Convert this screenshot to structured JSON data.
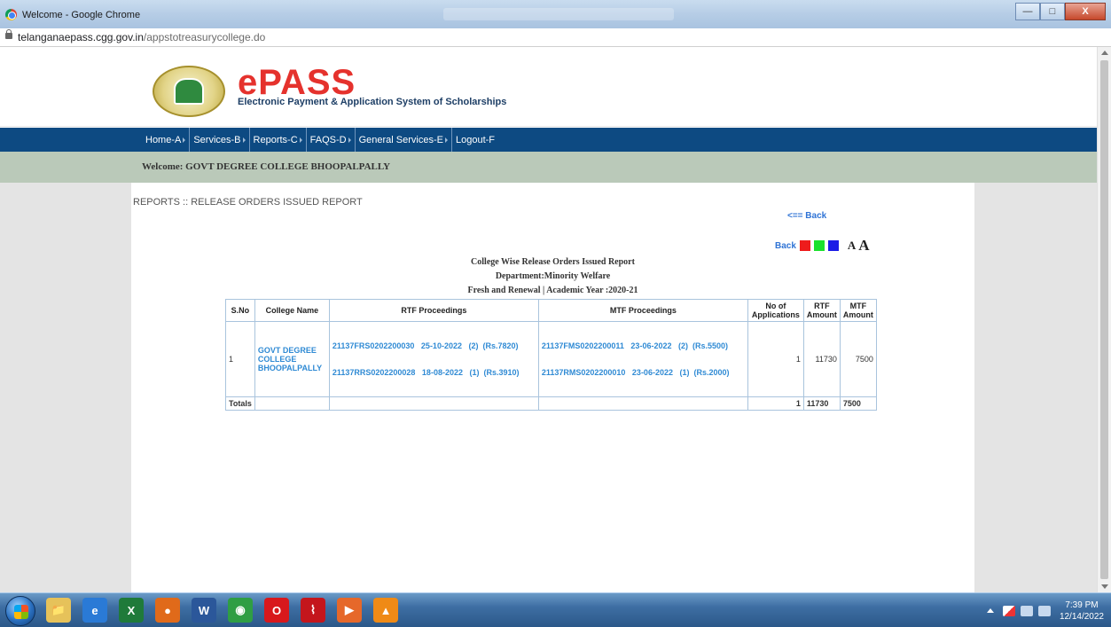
{
  "window": {
    "title": "Welcome - Google Chrome",
    "minimize": "—",
    "maximize": "□",
    "close": "X"
  },
  "address": {
    "host": "telanganaepass.cgg.gov.in",
    "path": "/appstotreasurycollege.do"
  },
  "header": {
    "logo_e": "e",
    "logo_pass": "PASS",
    "tagline": "Electronic Payment & Application System of Scholarships"
  },
  "menu": {
    "items": [
      {
        "label": "Home-A"
      },
      {
        "label": "Services-B"
      },
      {
        "label": "Reports-C"
      },
      {
        "label": "FAQS-D"
      },
      {
        "label": "General Services-E"
      },
      {
        "label": "Logout-F"
      }
    ]
  },
  "welcome": "Welcome: GOVT DEGREE COLLEGE BHOOPALPALLY",
  "report": {
    "breadcrumb": "REPORTS :: RELEASE ORDERS ISSUED REPORT",
    "back_top": "<== Back",
    "tools_back": "Back",
    "font_small": "A",
    "font_large": "A",
    "heading1": "College Wise Release Orders Issued Report",
    "heading2": "Department:Minority Welfare",
    "heading3": "Fresh and Renewal | Academic Year :2020-21",
    "columns": {
      "sno": "S.No",
      "college": "College Name",
      "rtf": "RTF Proceedings",
      "mtf": "MTF Proceedings",
      "noapp_1": "No of",
      "noapp_2": "Applications",
      "rtfamt_1": "RTF",
      "rtfamt_2": "Amount",
      "mtfamt_1": "MTF",
      "mtfamt_2": "Amount"
    },
    "rows": [
      {
        "sno": "1",
        "college": "GOVT DEGREE COLLEGE BHOOPALPALLY",
        "rtf": [
          "21137FRS0202200030   25-10-2022   (2)  (Rs.7820)",
          "21137RRS0202200028   18-08-2022   (1)  (Rs.3910)"
        ],
        "mtf": [
          "21137FMS0202200011   23-06-2022   (2)  (Rs.5500)",
          "21137RMS0202200010   23-06-2022   (1)  (Rs.2000)"
        ],
        "applications": "1",
        "rtf_amount": "11730",
        "mtf_amount": "7500"
      }
    ],
    "totals": {
      "label": "Totals",
      "applications": "1",
      "rtf_amount": "11730",
      "mtf_amount": "7500"
    }
  },
  "taskbar": {
    "apps": [
      {
        "name": "explorer",
        "label": "📁",
        "color": "#e6c25a"
      },
      {
        "name": "ie",
        "label": "e",
        "color": "#2a7ad6"
      },
      {
        "name": "excel",
        "label": "X",
        "color": "#1f7a3a"
      },
      {
        "name": "firefox",
        "label": "●",
        "color": "#e06a1a"
      },
      {
        "name": "word",
        "label": "W",
        "color": "#2b579a"
      },
      {
        "name": "chrome",
        "label": "◉",
        "color": "#2f9e44"
      },
      {
        "name": "opera",
        "label": "O",
        "color": "#d8181c"
      },
      {
        "name": "acrobat",
        "label": "⌇",
        "color": "#c4161c"
      },
      {
        "name": "media",
        "label": "▶",
        "color": "#e6682a"
      },
      {
        "name": "vlc",
        "label": "▲",
        "color": "#ef8a16"
      }
    ],
    "clock_time": "7:39 PM",
    "clock_date": "12/14/2022"
  }
}
